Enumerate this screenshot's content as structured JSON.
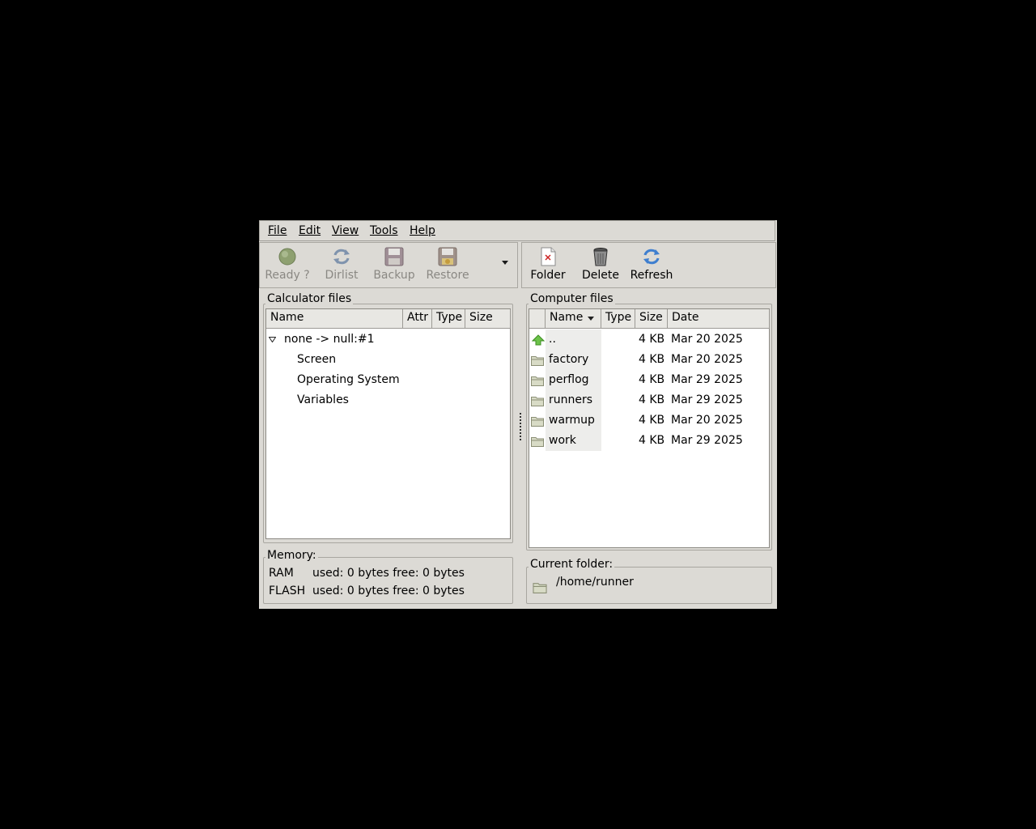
{
  "menu": {
    "file": "File",
    "edit": "Edit",
    "view": "View",
    "tools": "Tools",
    "help": "Help"
  },
  "toolbar_left": {
    "ready": "Ready ?",
    "dirlist": "Dirlist",
    "backup": "Backup",
    "restore": "Restore"
  },
  "toolbar_right": {
    "folder": "Folder",
    "delete": "Delete",
    "refresh": "Refresh"
  },
  "calc": {
    "title": "Calculator files",
    "columns": [
      "Name",
      "Attr",
      "Type",
      "Size"
    ],
    "root": "none -> null:#1",
    "children": [
      "Screen",
      "Operating System",
      "Variables"
    ]
  },
  "memory": {
    "title": "Memory:",
    "ram_label": "RAM",
    "ram_value": "used: 0 bytes free: 0 bytes",
    "flash_label": "FLASH",
    "flash_value": "used: 0 bytes free: 0 bytes"
  },
  "computer": {
    "title": "Computer files",
    "columns": [
      "Name",
      "Type",
      "Size",
      "Date"
    ],
    "rows": [
      {
        "name": "..",
        "type": "",
        "size": "4 KB",
        "date": "Mar 20 2025"
      },
      {
        "name": "factory",
        "type": "",
        "size": "4 KB",
        "date": "Mar 20 2025"
      },
      {
        "name": "perflog",
        "type": "",
        "size": "4 KB",
        "date": "Mar 29 2025"
      },
      {
        "name": "runners",
        "type": "",
        "size": "4 KB",
        "date": "Mar 29 2025"
      },
      {
        "name": "warmup",
        "type": "",
        "size": "4 KB",
        "date": "Mar 20 2025"
      },
      {
        "name": "work",
        "type": "",
        "size": "4 KB",
        "date": "Mar 29 2025"
      }
    ]
  },
  "current_folder": {
    "title": "Current folder:",
    "path": "/home/runner"
  }
}
